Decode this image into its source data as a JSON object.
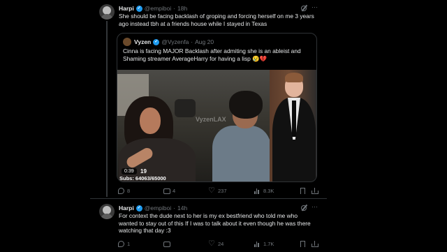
{
  "tweets": [
    {
      "name": "Harpi",
      "handle": "@empiboi",
      "separator": "·",
      "time": "18h",
      "more": "···",
      "text": "She should be facing backlash of groping and forcing herself on me 3 years ago instead tbh at a friends house while I stayed in Texas",
      "quote": {
        "name": "Vyzen",
        "handle": "@Vyzenfa",
        "separator": "·",
        "date": "Aug 20",
        "text": "Cinna is facing MAJOR Backlash after admiting she is an ableist and Shaming streamer AverageHarry for having a lisp 😢💔",
        "video": {
          "timer": "0:39",
          "overlay_number": "19",
          "subs_text": "Subs: 64063/65000",
          "watermark": "VyzenLAX"
        }
      },
      "actions": {
        "replies": "8",
        "reposts": "4",
        "likes": "237",
        "views": "8.3K"
      }
    },
    {
      "name": "Harpi",
      "handle": "@empiboi",
      "separator": "·",
      "time": "14h",
      "more": "···",
      "text": "For context the dude next to her is my ex bestfriend who told me who wanted to stay out of this If I was to talk about it even though he was there watching that day :3",
      "actions": {
        "replies": "1",
        "reposts": "",
        "likes": "24",
        "views": "1.7K"
      }
    }
  ],
  "colors": {
    "background": "#000000",
    "text": "#e7e9ea",
    "muted": "#71767b",
    "verified": "#1d9bf0",
    "border": "#2f3336"
  },
  "icons": [
    "reply-icon",
    "repost-icon",
    "like-icon",
    "views-icon",
    "bookmark-icon",
    "share-icon",
    "grok-icon",
    "more-icon",
    "verified-icon"
  ]
}
